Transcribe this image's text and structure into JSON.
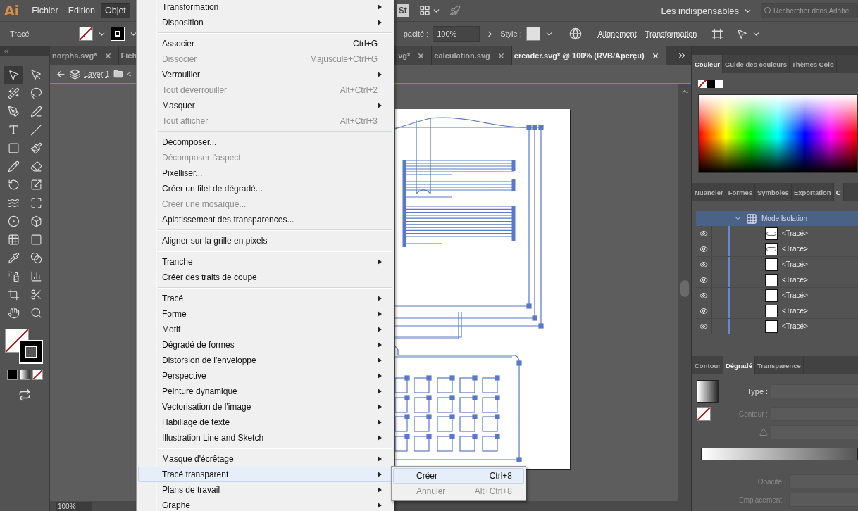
{
  "menubar": {
    "logo": "Ai",
    "menus": [
      {
        "label": "Fichier",
        "selected": false
      },
      {
        "label": "Edition",
        "selected": false
      },
      {
        "label": "Objet",
        "selected": true
      }
    ],
    "stock_badge": "St",
    "workspace": "Les indispensables",
    "search": {
      "placeholder": "Rechercher dans Adobe"
    }
  },
  "control_bar": {
    "selection": "Tracé",
    "opacity_label": "pacité :",
    "opacity": "100%",
    "style_label": "Style :",
    "links": [
      "Alignement",
      "Transformation"
    ]
  },
  "tools": [
    {
      "kind": "select",
      "selected": true
    },
    {
      "kind": "direct",
      "selected": false
    },
    {
      "kind": "wand",
      "selected": false
    },
    {
      "kind": "lasso",
      "selected": false
    },
    {
      "kind": "pen",
      "selected": false
    },
    {
      "kind": "curvature",
      "selected": false
    },
    {
      "kind": "type",
      "selected": false
    },
    {
      "kind": "line",
      "selected": false
    },
    {
      "kind": "rect",
      "selected": false
    },
    {
      "kind": "brush",
      "selected": false
    },
    {
      "kind": "shaper",
      "selected": false
    },
    {
      "kind": "eraser",
      "selected": false
    },
    {
      "kind": "rotate",
      "selected": false
    },
    {
      "kind": "scale",
      "selected": false
    },
    {
      "kind": "warp",
      "selected": false
    },
    {
      "kind": "free",
      "selected": false
    },
    {
      "kind": "builder",
      "selected": false
    },
    {
      "kind": "perspective",
      "selected": false
    },
    {
      "kind": "mesh",
      "selected": false
    },
    {
      "kind": "gradient",
      "selected": false
    },
    {
      "kind": "eyedropper",
      "selected": false
    },
    {
      "kind": "blend",
      "selected": false
    },
    {
      "kind": "spray",
      "selected": false
    },
    {
      "kind": "graph",
      "selected": false
    },
    {
      "kind": "artboard",
      "selected": false
    },
    {
      "kind": "slice",
      "selected": false
    },
    {
      "kind": "hand",
      "selected": false
    },
    {
      "kind": "zoom",
      "selected": false
    }
  ],
  "document_tabs": {
    "left": [
      {
        "label": "norphs.svg*",
        "close": true,
        "selected": false
      },
      {
        "label": "Fich",
        "close": false,
        "selected": false
      }
    ],
    "right": [
      {
        "label": "vg*",
        "close": true,
        "selected": false
      },
      {
        "label": "calculation.svg",
        "close": true,
        "selected": false
      },
      {
        "label": "ereader.svg* @ 100% (RVB/Aperçu)",
        "close": true,
        "selected": true
      }
    ]
  },
  "breadcrumb": {
    "layer": "Layer 1",
    "path": "<"
  },
  "zoom": "100%",
  "color_panel": {
    "tabs": [
      {
        "label": "Couleur",
        "selected": true
      },
      {
        "label": "Guide des couleurs",
        "selected": false
      },
      {
        "label": "Thèmes Colo",
        "selected": false
      }
    ]
  },
  "layers_panel": {
    "tabs": [
      {
        "label": "Nuancier",
        "selected": false
      },
      {
        "label": "Formes",
        "selected": false
      },
      {
        "label": "Symboles",
        "selected": false
      },
      {
        "label": "Exportation",
        "selected": false
      },
      {
        "label": "C",
        "selected": true
      }
    ],
    "isolation": "Mode Isolation",
    "rows": [
      {
        "name": "<Tracé>",
        "visible": true,
        "kind": "rounded"
      },
      {
        "name": "<Tracé>",
        "visible": true,
        "kind": "rounded"
      },
      {
        "name": "<Tracé>",
        "visible": true,
        "kind": "plain"
      },
      {
        "name": "<Tracé>",
        "visible": true,
        "kind": "plain"
      },
      {
        "name": "<Tracé>",
        "visible": true,
        "kind": "plain"
      },
      {
        "name": "<Tracé>",
        "visible": true,
        "kind": "plain"
      },
      {
        "name": "<Tracé>",
        "visible": true,
        "kind": "plain"
      }
    ]
  },
  "gradient_panel": {
    "tabs": [
      {
        "label": "Contour",
        "selected": false
      },
      {
        "label": "Dégradé",
        "selected": true
      },
      {
        "label": "Transparence",
        "selected": false
      }
    ],
    "type_label": "Type :",
    "stroke_label": "Contour :",
    "opacity_label": "Opacité :",
    "location_label": "Emplacement :"
  },
  "object_menu": {
    "groups": [
      [
        {
          "label": "Transformation",
          "submenu": true,
          "disabled": false,
          "selected": false
        },
        {
          "label": "Disposition",
          "submenu": true,
          "disabled": false,
          "selected": false
        }
      ],
      [
        {
          "label": "Associer",
          "shortcut": "Ctrl+G",
          "submenu": false,
          "disabled": false,
          "selected": false
        },
        {
          "label": "Dissocier",
          "shortcut": "Majuscule+Ctrl+G",
          "submenu": false,
          "disabled": true,
          "selected": false
        },
        {
          "label": "Verrouiller",
          "submenu": true,
          "disabled": false,
          "selected": false
        },
        {
          "label": "Tout déverrouiller",
          "shortcut": "Alt+Ctrl+2",
          "submenu": false,
          "disabled": true,
          "selected": false
        },
        {
          "label": "Masquer",
          "submenu": true,
          "disabled": false,
          "selected": false
        },
        {
          "label": "Tout afficher",
          "shortcut": "Alt+Ctrl+3",
          "submenu": false,
          "disabled": true,
          "selected": false
        }
      ],
      [
        {
          "label": "Décomposer...",
          "submenu": false,
          "disabled": false,
          "selected": false
        },
        {
          "label": "Décomposer l'aspect",
          "submenu": false,
          "disabled": true,
          "selected": false
        },
        {
          "label": "Pixelliser...",
          "submenu": false,
          "disabled": false,
          "selected": false
        },
        {
          "label": "Créer un filet de dégradé...",
          "submenu": false,
          "disabled": false,
          "selected": false
        },
        {
          "label": "Créer une mosaïque...",
          "submenu": false,
          "disabled": true,
          "selected": false
        },
        {
          "label": "Aplatissement des transparences...",
          "submenu": false,
          "disabled": false,
          "selected": false
        }
      ],
      [
        {
          "label": "Aligner sur la grille en pixels",
          "submenu": false,
          "disabled": false,
          "selected": false
        }
      ],
      [
        {
          "label": "Tranche",
          "submenu": true,
          "disabled": false,
          "selected": false
        },
        {
          "label": "Créer des traits de coupe",
          "submenu": false,
          "disabled": false,
          "selected": false
        }
      ],
      [
        {
          "label": "Tracé",
          "submenu": true,
          "disabled": false,
          "selected": false
        },
        {
          "label": "Forme",
          "submenu": true,
          "disabled": false,
          "selected": false
        },
        {
          "label": "Motif",
          "submenu": true,
          "disabled": false,
          "selected": false
        },
        {
          "label": "Dégradé de formes",
          "submenu": true,
          "disabled": false,
          "selected": false
        },
        {
          "label": "Distorsion de l'enveloppe",
          "submenu": true,
          "disabled": false,
          "selected": false
        },
        {
          "label": "Perspective",
          "submenu": true,
          "disabled": false,
          "selected": false
        },
        {
          "label": "Peinture dynamique",
          "submenu": true,
          "disabled": false,
          "selected": false
        },
        {
          "label": "Vectorisation de l'image",
          "submenu": true,
          "disabled": false,
          "selected": false
        },
        {
          "label": "Habillage de texte",
          "submenu": true,
          "disabled": false,
          "selected": false
        },
        {
          "label": "Illustration Line and Sketch",
          "submenu": true,
          "disabled": false,
          "selected": false
        }
      ],
      [
        {
          "label": "Masque d'écrêtage",
          "submenu": true,
          "disabled": false,
          "selected": false
        },
        {
          "label": "Tracé transparent",
          "submenu": true,
          "disabled": false,
          "selected": true
        },
        {
          "label": "Plans de travail",
          "submenu": true,
          "disabled": false,
          "selected": false
        },
        {
          "label": "Graphe",
          "submenu": true,
          "disabled": false,
          "selected": false
        }
      ]
    ]
  },
  "submenu": {
    "items": [
      {
        "label": "Créer",
        "shortcut": "Ctrl+8",
        "disabled": false,
        "selected": true
      },
      {
        "label": "Annuler",
        "shortcut": "Alt+Ctrl+8",
        "disabled": true,
        "selected": false
      }
    ]
  }
}
